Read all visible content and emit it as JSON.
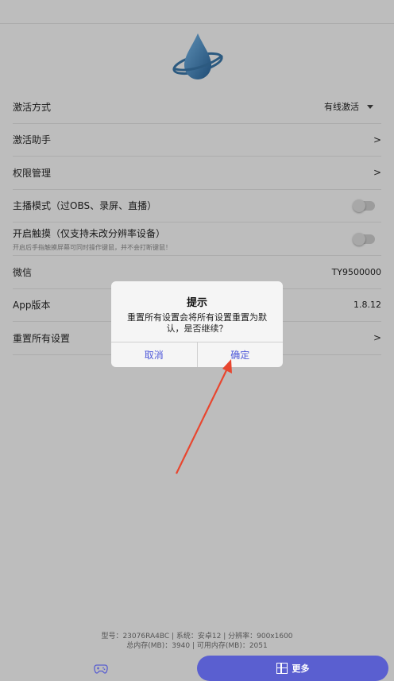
{
  "settings": {
    "rows": [
      {
        "label": "激活方式",
        "value": "有线激活"
      },
      {
        "label": "激活助手",
        "value": ">"
      },
      {
        "label": "权限管理",
        "value": ">"
      },
      {
        "label": "主播模式（过OBS、录屏、直播）"
      },
      {
        "label": "开启触摸（仅支持未改分辨率设备）",
        "sub": "开启后手指触摸屏幕可同时操作键鼠，并不会打断键鼠！"
      },
      {
        "label": "微信",
        "value": "TY9500000"
      },
      {
        "label": "App版本",
        "value": "1.8.12"
      },
      {
        "label": "重置所有设置",
        "value": ">"
      }
    ]
  },
  "device_info": {
    "line1": "型号：23076RA4BC | 系统：安卓12 | 分辨率：900x1600",
    "line2": "总内存(MB)：3940 | 可用内存(MB)：2051"
  },
  "bottom": {
    "more_label": "更多"
  },
  "dialog": {
    "title": "提示",
    "message": "重置所有设置会将所有设置重置为默认，是否继续？",
    "cancel": "取消",
    "confirm": "确定"
  },
  "colors": {
    "accent": "#5a5fd0",
    "dialog_button": "#4e58d9",
    "arrow": "#e8462f"
  }
}
